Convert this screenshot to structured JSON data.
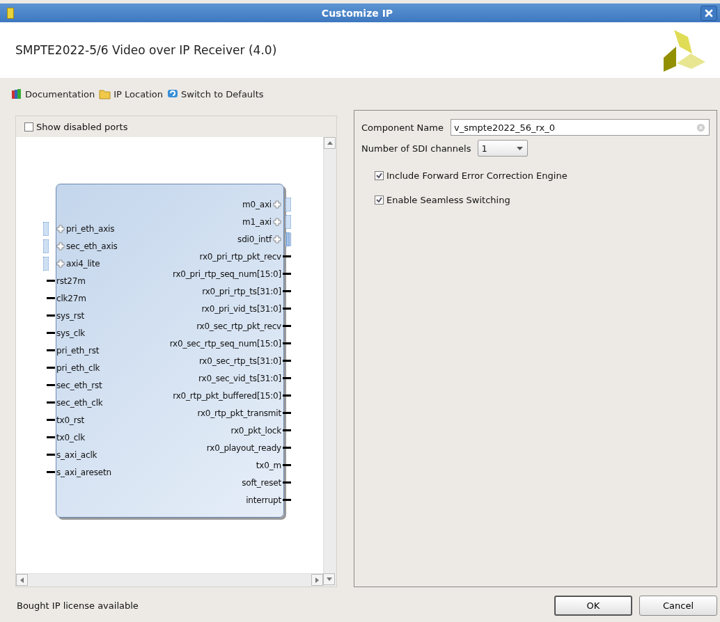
{
  "window": {
    "title": "Customize IP"
  },
  "header": {
    "title": "SMPTE2022-5/6 Video over IP Receiver (4.0)"
  },
  "toolbar": [
    {
      "label": "Documentation",
      "kind": "books"
    },
    {
      "label": "IP Location",
      "kind": "folder"
    },
    {
      "label": "Switch to Defaults",
      "kind": "reset"
    }
  ],
  "left_panel": {
    "show_disabled_ports": {
      "label": "Show disabled ports",
      "checked": false
    },
    "block": {
      "left_ports": [
        {
          "name": "pri_eth_axis",
          "kind": "interface"
        },
        {
          "name": "sec_eth_axis",
          "kind": "interface"
        },
        {
          "name": "axi4_lite",
          "kind": "lite"
        },
        {
          "name": "rst27m",
          "kind": "wire"
        },
        {
          "name": "clk27m",
          "kind": "wire"
        },
        {
          "name": "sys_rst",
          "kind": "wire"
        },
        {
          "name": "sys_clk",
          "kind": "wire"
        },
        {
          "name": "pri_eth_rst",
          "kind": "wire"
        },
        {
          "name": "pri_eth_clk",
          "kind": "wire"
        },
        {
          "name": "sec_eth_rst",
          "kind": "wire"
        },
        {
          "name": "sec_eth_clk",
          "kind": "wire"
        },
        {
          "name": "tx0_rst",
          "kind": "wire"
        },
        {
          "name": "tx0_clk",
          "kind": "wire"
        },
        {
          "name": "s_axi_aclk",
          "kind": "wire"
        },
        {
          "name": "s_axi_aresetn",
          "kind": "wire"
        }
      ],
      "right_ports": [
        {
          "name": "m0_axi",
          "kind": "lite"
        },
        {
          "name": "m1_axi",
          "kind": "lite"
        },
        {
          "name": "sdi0_intf",
          "kind": "interface"
        },
        {
          "name": "rx0_pri_rtp_pkt_recv",
          "kind": "wire"
        },
        {
          "name": "rx0_pri_rtp_seq_num[15:0]",
          "kind": "bus"
        },
        {
          "name": "rx0_pri_rtp_ts[31:0]",
          "kind": "bus"
        },
        {
          "name": "rx0_pri_vid_ts[31:0]",
          "kind": "bus"
        },
        {
          "name": "rx0_sec_rtp_pkt_recv",
          "kind": "wire"
        },
        {
          "name": "rx0_sec_rtp_seq_num[15:0]",
          "kind": "bus"
        },
        {
          "name": "rx0_sec_rtp_ts[31:0]",
          "kind": "bus"
        },
        {
          "name": "rx0_sec_vid_ts[31:0]",
          "kind": "bus"
        },
        {
          "name": "rx0_rtp_pkt_buffered[15:0]",
          "kind": "bus"
        },
        {
          "name": "rx0_rtp_pkt_transmit",
          "kind": "wire"
        },
        {
          "name": "rx0_pkt_lock",
          "kind": "wire"
        },
        {
          "name": "rx0_playout_ready",
          "kind": "wire"
        },
        {
          "name": "tx0_m",
          "kind": "wire"
        },
        {
          "name": "soft_reset",
          "kind": "wire"
        },
        {
          "name": "interrupt",
          "kind": "wire"
        }
      ]
    }
  },
  "right_panel": {
    "component_name": {
      "label": "Component Name",
      "value": "v_smpte2022_56_rx_0"
    },
    "sdi_channels": {
      "label": "Number of SDI channels",
      "value": "1"
    },
    "options": [
      {
        "label": "Include Forward Error Correction Engine",
        "checked": true
      },
      {
        "label": "Enable Seamless Switching",
        "checked": true
      }
    ]
  },
  "footer": {
    "status": "Bought IP license available",
    "buttons": [
      {
        "label": "OK",
        "default": true
      },
      {
        "label": "Cancel",
        "default": false
      }
    ]
  }
}
